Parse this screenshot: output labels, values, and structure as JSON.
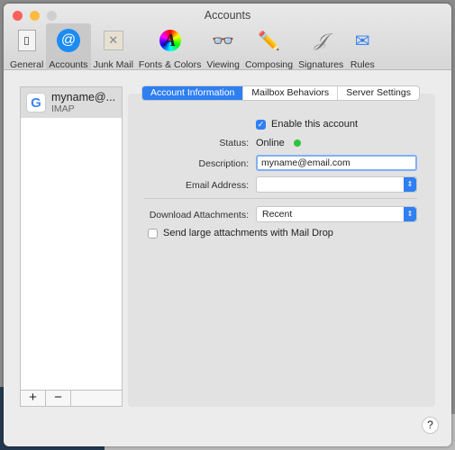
{
  "window": {
    "title": "Accounts"
  },
  "toolbar": [
    {
      "label": "General",
      "icon": "general-switch-icon"
    },
    {
      "label": "Accounts",
      "icon": "at-sign-icon",
      "selected": true
    },
    {
      "label": "Junk Mail",
      "icon": "junk-mail-icon"
    },
    {
      "label": "Fonts & Colors",
      "icon": "fonts-colors-icon"
    },
    {
      "label": "Viewing",
      "icon": "glasses-icon"
    },
    {
      "label": "Composing",
      "icon": "pencil-icon"
    },
    {
      "label": "Signatures",
      "icon": "signature-icon"
    },
    {
      "label": "Rules",
      "icon": "rules-icon"
    }
  ],
  "accounts": [
    {
      "name": "myname@...",
      "type": "IMAP",
      "logo": "G"
    }
  ],
  "list_buttons": {
    "add": "+",
    "remove": "−"
  },
  "tabs": [
    {
      "label": "Account Information",
      "selected": true
    },
    {
      "label": "Mailbox Behaviors"
    },
    {
      "label": "Server Settings"
    }
  ],
  "form": {
    "enable_label": "Enable this account",
    "enable_checked": true,
    "status_label": "Status:",
    "status_value": "Online",
    "status_color": "#2ec440",
    "description_label": "Description:",
    "description_value": "myname@email.com",
    "email_label": "Email Address:",
    "email_value": "",
    "download_label": "Download Attachments:",
    "download_value": "Recent",
    "maildrop_label": "Send large attachments with Mail Drop",
    "maildrop_checked": false
  },
  "help": "?",
  "colors": {
    "accent": "#2f7ff3"
  }
}
